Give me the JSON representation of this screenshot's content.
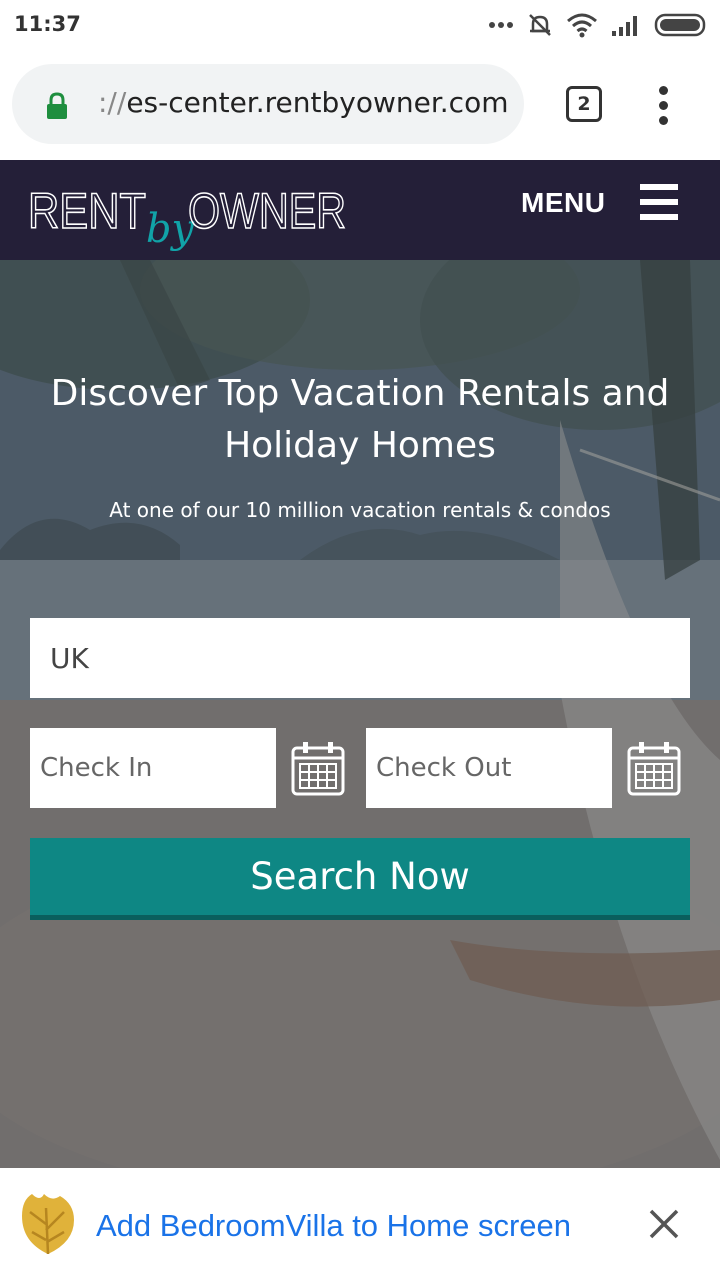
{
  "status_bar": {
    "time": "11:37",
    "icons": [
      "more-dots-icon",
      "silent-icon",
      "wifi-icon",
      "signal-icon",
      "battery-icon"
    ]
  },
  "browser": {
    "url_scheme": "://",
    "url_host": "es-center.rentbyowner.com",
    "tab_count": "2",
    "icons": [
      "lock-icon",
      "kebab-menu-icon"
    ]
  },
  "header": {
    "logo": {
      "part1": "RENT",
      "part2": "by",
      "part3": "OWNER"
    },
    "menu_label": "MENU",
    "icons": [
      "hamburger-icon"
    ],
    "colors": {
      "background": "#241f38",
      "logo_accent": "#11a3a8"
    }
  },
  "hero": {
    "title": "Discover Top Vacation Rentals and Holiday Homes",
    "subtitle": "At one of our 10 million vacation rentals & condos"
  },
  "search_form": {
    "location_value": "UK",
    "check_in_placeholder": "Check In",
    "check_out_placeholder": "Check Out",
    "search_label": "Search Now",
    "icons": [
      "calendar-icon",
      "calendar-icon"
    ],
    "colors": {
      "button": "#0e8784"
    }
  },
  "banner": {
    "text": "Add BedroomVilla to Home screen",
    "icons": [
      "leaf-icon",
      "close-icon"
    ],
    "colors": {
      "text": "#1a73e8",
      "leaf": "#e0b23a"
    }
  }
}
